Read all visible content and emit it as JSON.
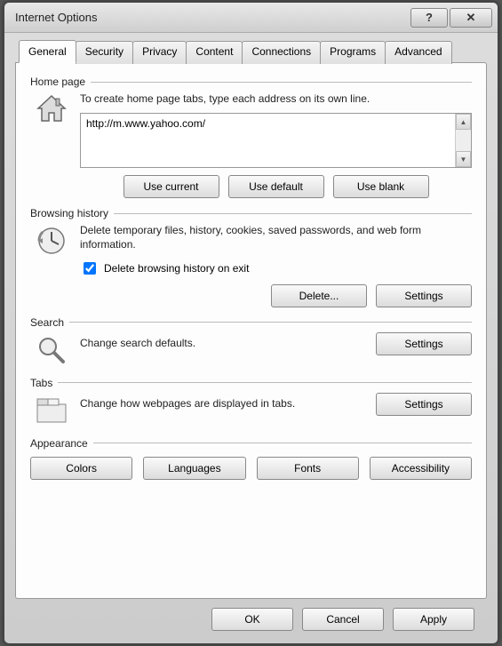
{
  "window": {
    "title": "Internet Options"
  },
  "tabs": [
    "General",
    "Security",
    "Privacy",
    "Content",
    "Connections",
    "Programs",
    "Advanced"
  ],
  "active_tab": 0,
  "homepage": {
    "group_label": "Home page",
    "desc": "To create home page tabs, type each address on its own line.",
    "value": "http://m.www.yahoo.com/",
    "use_current": "Use current",
    "use_default": "Use default",
    "use_blank": "Use blank"
  },
  "history": {
    "group_label": "Browsing history",
    "desc": "Delete temporary files, history, cookies, saved passwords, and web form information.",
    "checkbox_label": "Delete browsing history on exit",
    "checkbox_checked": true,
    "delete": "Delete...",
    "settings": "Settings"
  },
  "search": {
    "group_label": "Search",
    "desc": "Change search defaults.",
    "settings": "Settings"
  },
  "tabs_section": {
    "group_label": "Tabs",
    "desc": "Change how webpages are displayed in tabs.",
    "settings": "Settings"
  },
  "appearance": {
    "group_label": "Appearance",
    "colors": "Colors",
    "languages": "Languages",
    "fonts": "Fonts",
    "accessibility": "Accessibility"
  },
  "footer": {
    "ok": "OK",
    "cancel": "Cancel",
    "apply": "Apply"
  }
}
